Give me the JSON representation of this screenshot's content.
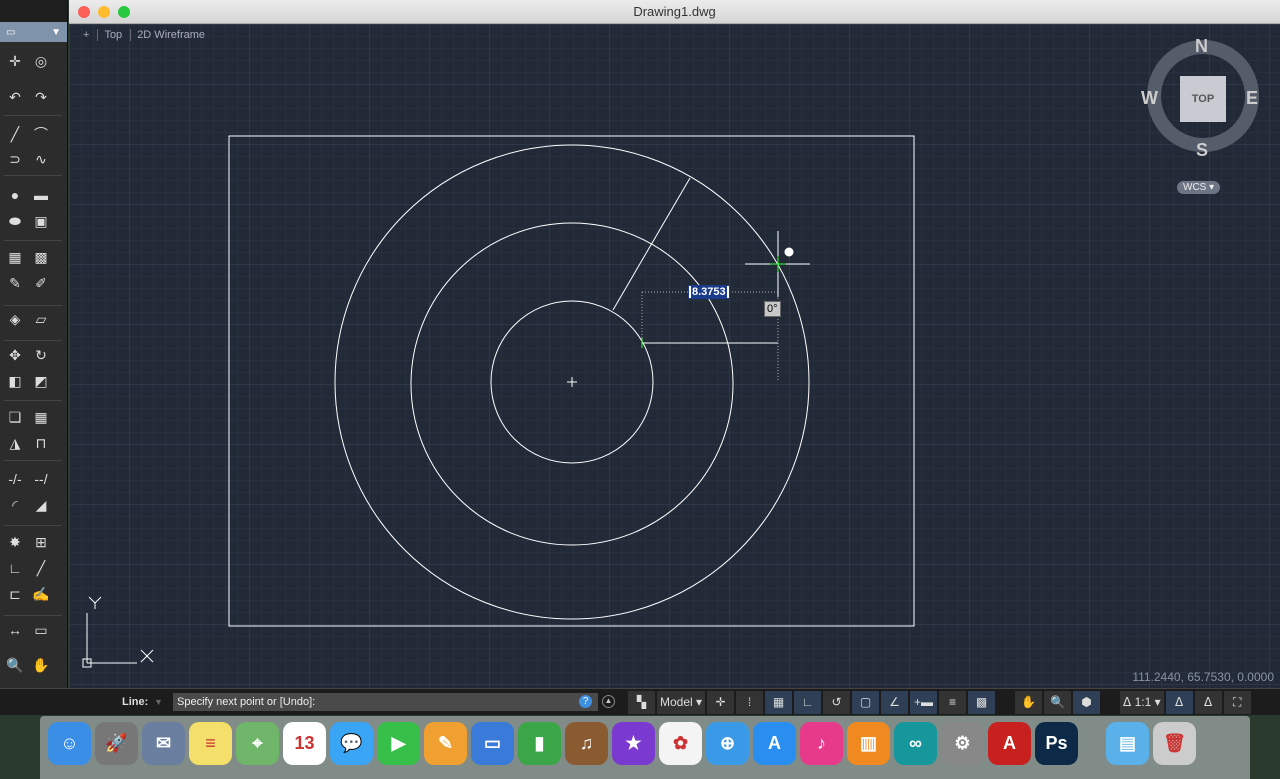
{
  "window": {
    "title": "Drawing1.dwg"
  },
  "viewport": {
    "plus": "+",
    "view": "Top",
    "style": "2D Wireframe"
  },
  "viewcube": {
    "n": "N",
    "s": "S",
    "e": "E",
    "w": "W",
    "face": "TOP",
    "ucs": "WCS"
  },
  "left_toolbar": {
    "rows": [
      [
        "crosshair-icon",
        "snap-icon"
      ],
      [
        "undo-icon",
        "redo-icon"
      ],
      [
        "line-icon",
        "polyline-icon"
      ],
      [
        "arc-icon",
        "spline-icon"
      ],
      [
        "circle-icon",
        "rectangle-icon"
      ],
      [
        "ellipse-icon",
        "region-icon"
      ],
      [
        "block-icon",
        "insert-icon"
      ],
      [
        "attribute-icon",
        "edit-attribute-icon"
      ],
      [
        "layer-icon",
        "erase-icon"
      ],
      [
        "move-icon",
        "rotate-icon"
      ],
      [
        "scale-icon",
        "stretch-icon"
      ],
      [
        "copy-icon",
        "array-icon"
      ],
      [
        "mirror-icon",
        "offset-icon"
      ],
      [
        "trim-icon",
        "extend-icon"
      ],
      [
        "fillet-icon",
        "chamfer-icon"
      ],
      [
        "explode-icon",
        "join-icon"
      ],
      [
        "dimension-icon",
        "leader-icon"
      ],
      [
        "table-icon",
        "text-icon"
      ],
      [
        "measure-icon",
        "area-icon"
      ],
      [
        "zoom-icon",
        "pan-icon"
      ]
    ]
  },
  "drawing": {
    "dimension_value": "8.3753",
    "angle_value": "0°",
    "axis_x": "X",
    "axis_y": "Y"
  },
  "coordinates": "111.2440, 65.7530, 0.0000",
  "command": {
    "label": "Line:",
    "prompt": "Specify next point or [Undo]:",
    "help": "?"
  },
  "status": {
    "model": "Model ▾",
    "scale": "1:1 ▾",
    "icons": [
      "layout-icon",
      "model-tab",
      "snap-icon",
      "grid-dots-icon",
      "grid-icon",
      "ortho-icon",
      "polar-icon",
      "osnap-icon",
      "otrack-icon",
      "lineweight-plus-icon",
      "properties-icon",
      "transparency-icon",
      "pan-icon",
      "zoom-icon",
      "orbit-icon",
      "annotation-scale",
      "annotation-visibility-icon",
      "auto-scale-icon",
      "fullscreen-icon"
    ]
  },
  "dock": [
    {
      "name": "finder",
      "c": "#3b8ee6",
      "g": "☺"
    },
    {
      "name": "launchpad",
      "c": "#777",
      "g": "🚀"
    },
    {
      "name": "preview",
      "c": "#6a7fa0",
      "g": "✉"
    },
    {
      "name": "notes",
      "c": "#f3df6a",
      "g": "≡"
    },
    {
      "name": "maps",
      "c": "#6fb66a",
      "g": "⌖"
    },
    {
      "name": "calendar",
      "c": "#fff",
      "g": "13"
    },
    {
      "name": "messages",
      "c": "#3aa5f5",
      "g": "💬"
    },
    {
      "name": "facetime",
      "c": "#36c04a",
      "g": "▶"
    },
    {
      "name": "pages",
      "c": "#f0a030",
      "g": "✎"
    },
    {
      "name": "keynote",
      "c": "#3a7ad8",
      "g": "▭"
    },
    {
      "name": "numbers",
      "c": "#3aa648",
      "g": "▮"
    },
    {
      "name": "garageband",
      "c": "#8a5a30",
      "g": "♫"
    },
    {
      "name": "imovie",
      "c": "#7a3ad0",
      "g": "★"
    },
    {
      "name": "photos",
      "c": "#f4f4f4",
      "g": "✿"
    },
    {
      "name": "safari",
      "c": "#3a9ae8",
      "g": "⊕"
    },
    {
      "name": "app-store",
      "c": "#2a8ef0",
      "g": "A"
    },
    {
      "name": "itunes",
      "c": "#e83a8a",
      "g": "♪"
    },
    {
      "name": "ibooks",
      "c": "#f08a20",
      "g": "▥"
    },
    {
      "name": "arduino",
      "c": "#15979c",
      "g": "∞"
    },
    {
      "name": "system-preferences",
      "c": "#888",
      "g": "⚙"
    },
    {
      "name": "autocad",
      "c": "#c8201e",
      "g": "A"
    },
    {
      "name": "photoshop",
      "c": "#0c2a48",
      "g": "Ps"
    },
    {
      "name": "downloads-folder",
      "c": "#5ab0e8",
      "g": "▤"
    },
    {
      "name": "trash",
      "c": "#ccc",
      "g": "🗑"
    }
  ]
}
